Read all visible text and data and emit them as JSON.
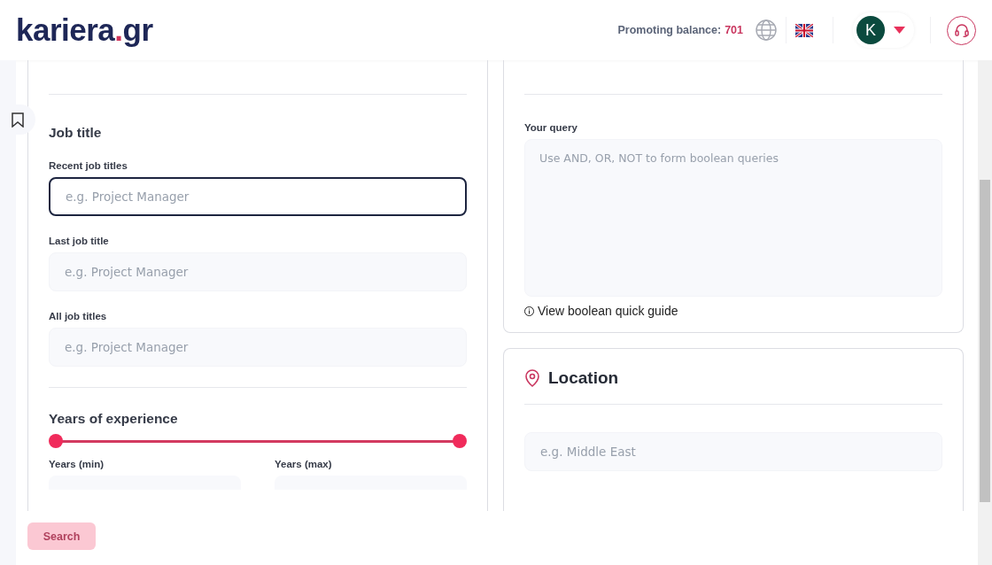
{
  "header": {
    "logo": {
      "main": "kariera",
      "dot": ".",
      "tld": "gr"
    },
    "balance_label": "Promoting balance:",
    "balance_value": "701",
    "avatar_letter": "K"
  },
  "job_title": {
    "heading": "Job title",
    "fields": [
      {
        "label": "Recent job titles",
        "placeholder": "e.g. Project Manager",
        "focused": true
      },
      {
        "label": "Last job title",
        "placeholder": "e.g. Project Manager",
        "focused": false
      },
      {
        "label": "All job titles",
        "placeholder": "e.g. Project Manager",
        "focused": false
      }
    ]
  },
  "experience": {
    "heading": "Years of experience",
    "thumbs": [
      {
        "level": 0
      },
      {
        "level": 1
      }
    ],
    "min_label": "Years (min)",
    "max_label": "Years (max)"
  },
  "query": {
    "label": "Your query",
    "placeholder": "Use AND, OR, NOT to form boolean queries",
    "guide_link": "View boolean quick guide"
  },
  "location": {
    "heading": "Location",
    "placeholder": "e.g. Middle East"
  },
  "search_button": {
    "label": "Search",
    "disabled": true
  }
}
